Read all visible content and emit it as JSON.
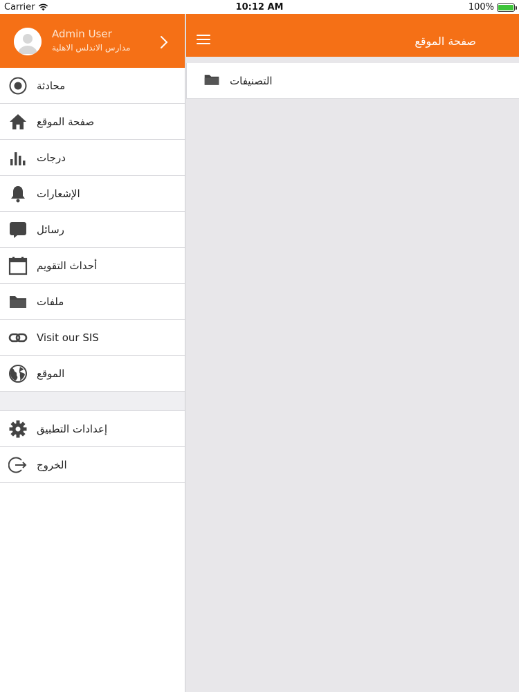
{
  "status_bar": {
    "carrier": "Carrier",
    "time": "10:12 AM",
    "battery": "100%"
  },
  "profile": {
    "name": "Admin User",
    "school": "مدارس الاندلس الاهلية"
  },
  "menu": [
    {
      "label": "محادثة",
      "icon": "chat-record-icon"
    },
    {
      "label": "صفحة الموقع",
      "icon": "home-icon"
    },
    {
      "label": "درجات",
      "icon": "bar-chart-icon"
    },
    {
      "label": "الإشعارات",
      "icon": "bell-icon"
    },
    {
      "label": "رسائل",
      "icon": "message-bubble-icon"
    },
    {
      "label": "أحداث التقويم",
      "icon": "calendar-icon"
    },
    {
      "label": "ملفات",
      "icon": "folder-icon"
    },
    {
      "label": "Visit our SIS",
      "icon": "link-icon"
    },
    {
      "label": "الموقع",
      "icon": "globe-icon"
    }
  ],
  "menu_secondary": [
    {
      "label": "إعدادات التطبيق",
      "icon": "gear-icon"
    },
    {
      "label": "الخروج",
      "icon": "logout-icon"
    }
  ],
  "navbar": {
    "title": "صفحة الموقع"
  },
  "content": {
    "rows": [
      {
        "label": "التصنيفات",
        "icon": "folder-icon"
      }
    ]
  },
  "colors": {
    "accent": "#f57016",
    "background": "#e8e7ea",
    "icon": "#444444"
  }
}
